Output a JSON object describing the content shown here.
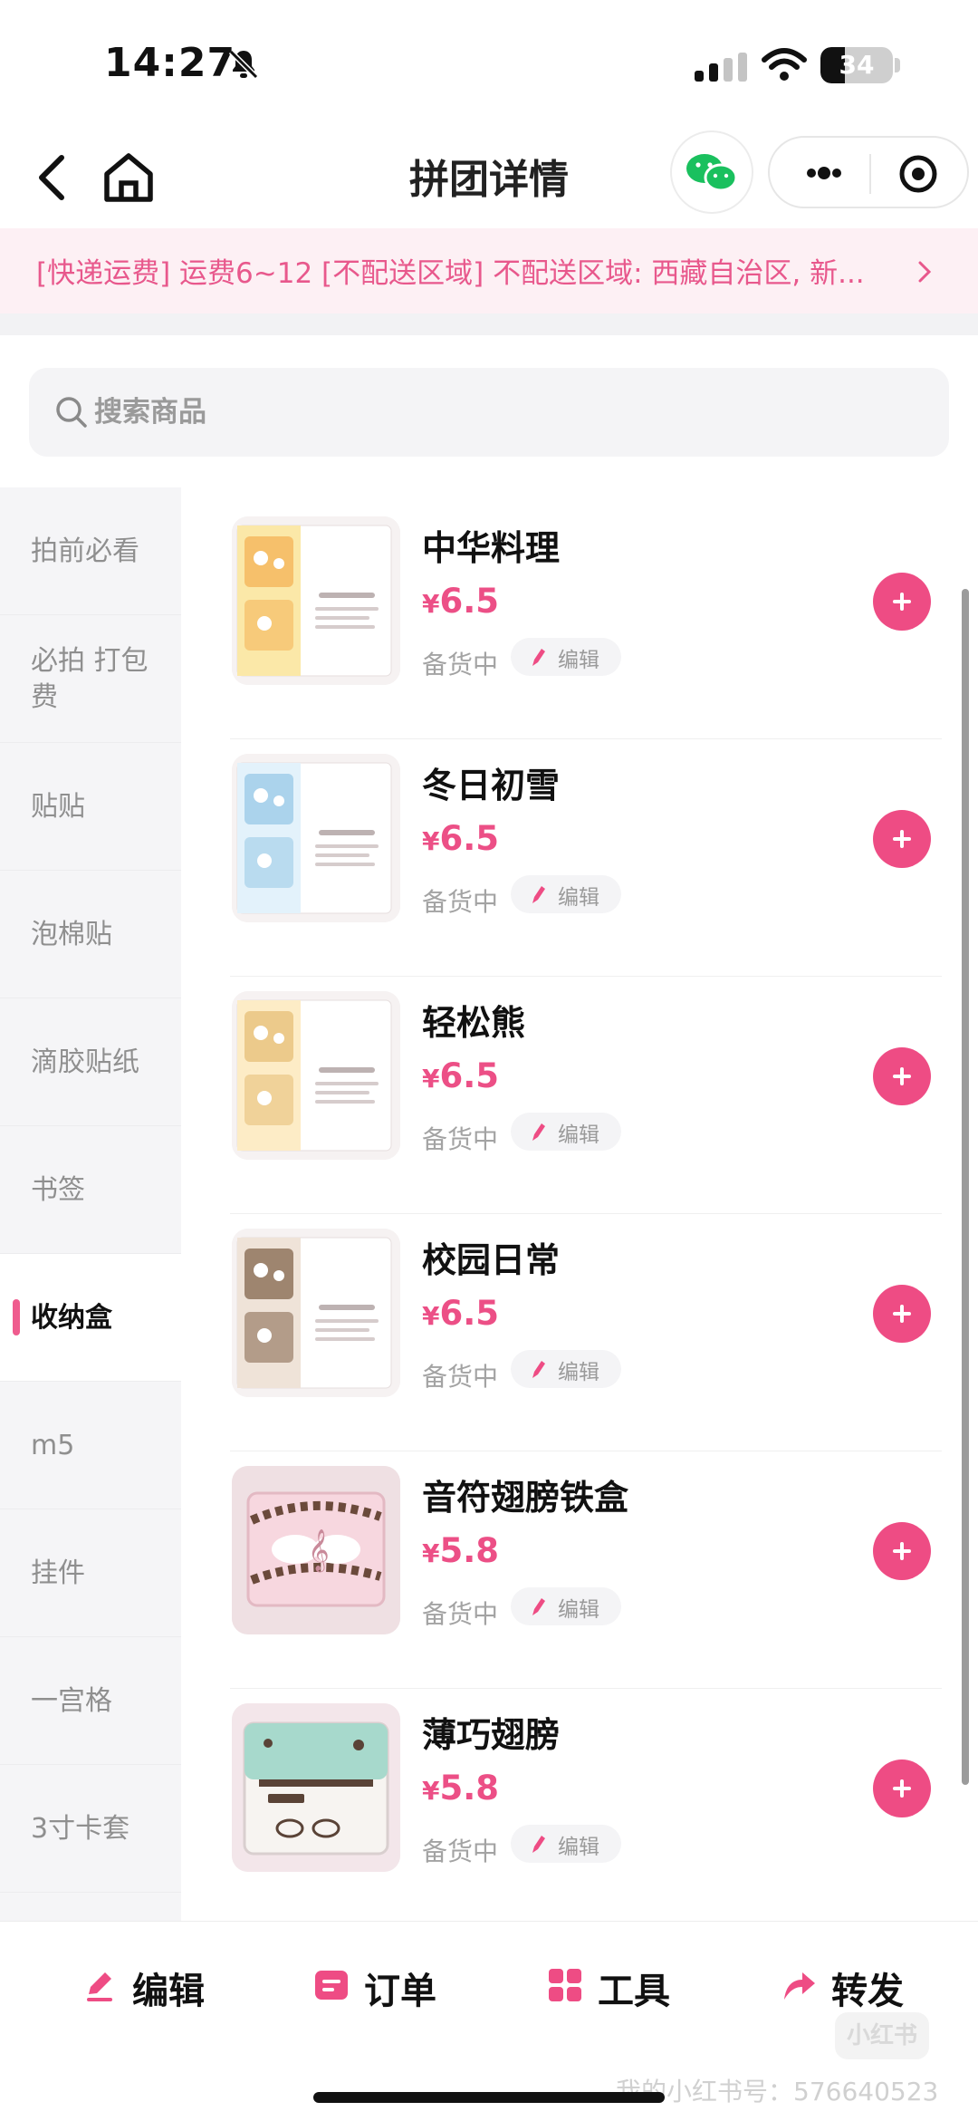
{
  "status_bar": {
    "time": "14:27",
    "battery": "34"
  },
  "nav": {
    "title": "拼团详情"
  },
  "notice": {
    "text": "[快递运费] 运费6~12 [不配送区域] 不配送区域: 西藏自治区, 新..."
  },
  "search": {
    "placeholder": "搜索商品"
  },
  "sidebar": {
    "items": [
      {
        "label": "拍前必看",
        "active": false
      },
      {
        "label": "必拍 打包费",
        "active": false
      },
      {
        "label": "贴贴",
        "active": false
      },
      {
        "label": "泡棉贴",
        "active": false
      },
      {
        "label": "滴胶贴纸",
        "active": false
      },
      {
        "label": "书签",
        "active": false
      },
      {
        "label": "收纳盒",
        "active": true
      },
      {
        "label": "m5",
        "active": false
      },
      {
        "label": "挂件",
        "active": false
      },
      {
        "label": "一宫格",
        "active": false
      },
      {
        "label": "3寸卡套",
        "active": false
      }
    ]
  },
  "currency": "¥",
  "products": [
    {
      "name": "中华料理",
      "price": "6.5",
      "stock": "备货中",
      "edit_label": "编辑",
      "thumb_style": "box-yellow"
    },
    {
      "name": "冬日初雪",
      "price": "6.5",
      "stock": "备货中",
      "edit_label": "编辑",
      "thumb_style": "box-blue"
    },
    {
      "name": "轻松熊",
      "price": "6.5",
      "stock": "备货中",
      "edit_label": "编辑",
      "thumb_style": "box-cream"
    },
    {
      "name": "校园日常",
      "price": "6.5",
      "stock": "备货中",
      "edit_label": "编辑",
      "thumb_style": "box-brown"
    },
    {
      "name": "音符翅膀铁盒",
      "price": "5.8",
      "stock": "备货中",
      "edit_label": "编辑",
      "thumb_style": "tin-pink"
    },
    {
      "name": "薄巧翅膀",
      "price": "5.8",
      "stock": "备货中",
      "edit_label": "编辑",
      "thumb_style": "tin-mint"
    }
  ],
  "bottom_bar": {
    "edit": "编辑",
    "orders": "订单",
    "tools": "工具",
    "share": "转发"
  },
  "watermark": {
    "badge": "小红书",
    "text": "我的小红书号：576640523"
  },
  "colors": {
    "accent": "#ee4c84",
    "notice_text": "#e8588c",
    "notice_bg": "#fdf0f4"
  }
}
